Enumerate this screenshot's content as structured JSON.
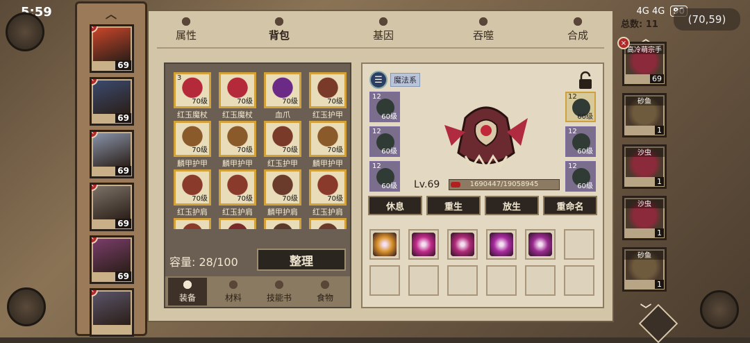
{
  "status": {
    "time": "5:59",
    "signal": "4G 4G",
    "battery": "90",
    "coords": "(70,59)"
  },
  "tabs": [
    {
      "label": "属性",
      "icon": "flame-icon"
    },
    {
      "label": "背包",
      "icon": "bag-icon"
    },
    {
      "label": "基因",
      "icon": "gene-icon"
    },
    {
      "label": "吞噬",
      "icon": "devour-icon"
    },
    {
      "label": "合成",
      "icon": "synthesis-icon"
    }
  ],
  "active_tab": "背包",
  "total_label": "总数: 11",
  "heroes": [
    {
      "level": "69",
      "color": "#c8452a"
    },
    {
      "level": "69",
      "color": "#3b4a6e"
    },
    {
      "level": "69",
      "color": "#8893a8"
    },
    {
      "level": "69",
      "color": "#7c7267"
    },
    {
      "level": "69",
      "color": "#7a3d6a"
    },
    {
      "level": "",
      "color": "#5a5468"
    }
  ],
  "bag": {
    "items": [
      {
        "name": "红玉魔杖",
        "level": "70级",
        "count": "3",
        "color": "#b52a3a"
      },
      {
        "name": "红玉魔杖",
        "level": "70级",
        "count": "",
        "color": "#b52a3a"
      },
      {
        "name": "血爪",
        "level": "70级",
        "count": "",
        "color": "#6b2a86"
      },
      {
        "name": "红玉护甲",
        "level": "70级",
        "count": "",
        "color": "#7a3a2a"
      },
      {
        "name": "麟甲护甲",
        "level": "70级",
        "count": "",
        "color": "#8a5a2a"
      },
      {
        "name": "麟甲护甲",
        "level": "70级",
        "count": "",
        "color": "#8a5a2a"
      },
      {
        "name": "红玉护甲",
        "level": "70级",
        "count": "",
        "color": "#7a3a2a"
      },
      {
        "name": "麟甲护甲",
        "level": "70级",
        "count": "",
        "color": "#8a5a2a"
      },
      {
        "name": "红玉护肩",
        "level": "70级",
        "count": "",
        "color": "#8a3a2a"
      },
      {
        "name": "红玉护肩",
        "level": "70级",
        "count": "",
        "color": "#8a3a2a"
      },
      {
        "name": "麟甲护肩",
        "level": "70级",
        "count": "",
        "color": "#6a3a2a"
      },
      {
        "name": "红玉护肩",
        "level": "70级",
        "count": "",
        "color": "#8a3a2a"
      },
      {
        "name": "",
        "level": "",
        "count": "",
        "color": "#8a3a2a"
      },
      {
        "name": "",
        "level": "",
        "count": "",
        "color": "#7a2a2a"
      },
      {
        "name": "",
        "level": "",
        "count": "",
        "color": "#5a3a2a"
      },
      {
        "name": "",
        "level": "",
        "count": "",
        "color": "#6a3a2a"
      }
    ],
    "capacity": "容量: 28/100",
    "sort_label": "整理",
    "bottom_tabs": [
      {
        "label": "装备",
        "icon": "hammer-icon"
      },
      {
        "label": "材料",
        "icon": "crate-icon"
      },
      {
        "label": "技能书",
        "icon": "scroll-icon"
      },
      {
        "label": "食物",
        "icon": "bread-icon"
      }
    ]
  },
  "detail": {
    "faction": "魔法系",
    "left_equips": [
      {
        "count": "12",
        "level": "60级"
      },
      {
        "count": "12",
        "level": "60级"
      },
      {
        "count": "12",
        "level": "60级"
      }
    ],
    "right_equips": [
      {
        "count": "12",
        "level": "60级"
      },
      {
        "count": "12",
        "level": "60级"
      },
      {
        "count": "12",
        "level": "60级"
      }
    ],
    "level": "Lv.69",
    "exp": "1690447/19058945",
    "exp_fraction": 0.089,
    "actions": [
      "休息",
      "重生",
      "放生",
      "重命名"
    ],
    "skills": [
      {
        "name": "golden-swirl",
        "color": "#d8902a"
      },
      {
        "name": "magic-burst",
        "color": "#c02a8a"
      },
      {
        "name": "magic-orb",
        "color": "#b02a78"
      },
      {
        "name": "magic-flare",
        "color": "#a82aa0"
      },
      {
        "name": "magic-star",
        "color": "#9a2a90"
      }
    ]
  },
  "pets": [
    {
      "name": "高冷萌宗手",
      "num": "69",
      "color": "#8a2a3a"
    },
    {
      "name": "砂鱼",
      "num": "1",
      "color": "#6e5a3c"
    },
    {
      "name": "沙虫",
      "num": "1",
      "color": "#8a2a3a"
    },
    {
      "name": "沙虫",
      "num": "1",
      "color": "#8a2a3a"
    },
    {
      "name": "砂鱼",
      "num": "1",
      "color": "#6e5a3c"
    }
  ]
}
